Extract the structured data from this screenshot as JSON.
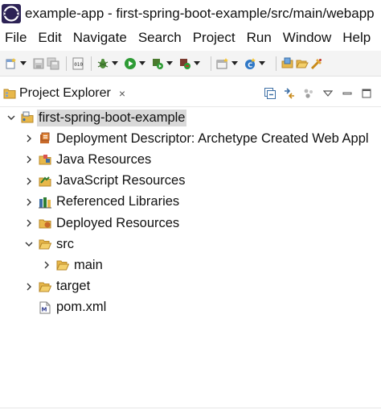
{
  "window": {
    "title": "example-app - first-spring-boot-example/src/main/webapp"
  },
  "menubar": {
    "items": [
      "File",
      "Edit",
      "Navigate",
      "Search",
      "Project",
      "Run",
      "Window",
      "Help"
    ]
  },
  "toolbar": {
    "buttons": [
      "new-icon",
      "save-icon",
      "save-all-icon",
      "binary-icon",
      "debug-icon",
      "run-icon",
      "run-config-icon",
      "external-tools-icon",
      "new-server-icon",
      "new-java-class-icon",
      "open-type-icon",
      "open-folder-icon",
      "search-icon"
    ]
  },
  "view": {
    "title": "Project Explorer",
    "close_symbol": "×",
    "actions": [
      "collapse-all-icon",
      "link-with-editor-icon",
      "focus-icon",
      "view-menu-icon",
      "minimize-icon",
      "maximize-icon"
    ]
  },
  "tree": {
    "items": [
      {
        "label": "first-spring-boot-example",
        "icon": "project-icon",
        "expanded": true,
        "depth": 0
      },
      {
        "label": "Deployment Descriptor: Archetype Created Web Appl",
        "icon": "deployment-descriptor-icon",
        "expanded": false,
        "depth": 1
      },
      {
        "label": "Java Resources",
        "icon": "java-resources-icon",
        "expanded": false,
        "depth": 1
      },
      {
        "label": "JavaScript Resources",
        "icon": "javascript-resources-icon",
        "expanded": false,
        "depth": 1
      },
      {
        "label": "Referenced Libraries",
        "icon": "library-icon",
        "expanded": false,
        "depth": 1
      },
      {
        "label": "Deployed Resources",
        "icon": "deployed-resources-icon",
        "expanded": false,
        "depth": 1
      },
      {
        "label": "src",
        "icon": "folder-icon",
        "expanded": true,
        "depth": 1
      },
      {
        "label": "main",
        "icon": "folder-icon",
        "expanded": false,
        "depth": 2
      },
      {
        "label": "target",
        "icon": "folder-icon",
        "expanded": false,
        "depth": 1
      },
      {
        "label": "pom.xml",
        "icon": "maven-file-icon",
        "expanded": null,
        "depth": 1
      }
    ]
  },
  "colors": {
    "selection": "#d9d9d9",
    "folder": "#e8b84a",
    "toolbar_bg": "#f4f4f4"
  }
}
